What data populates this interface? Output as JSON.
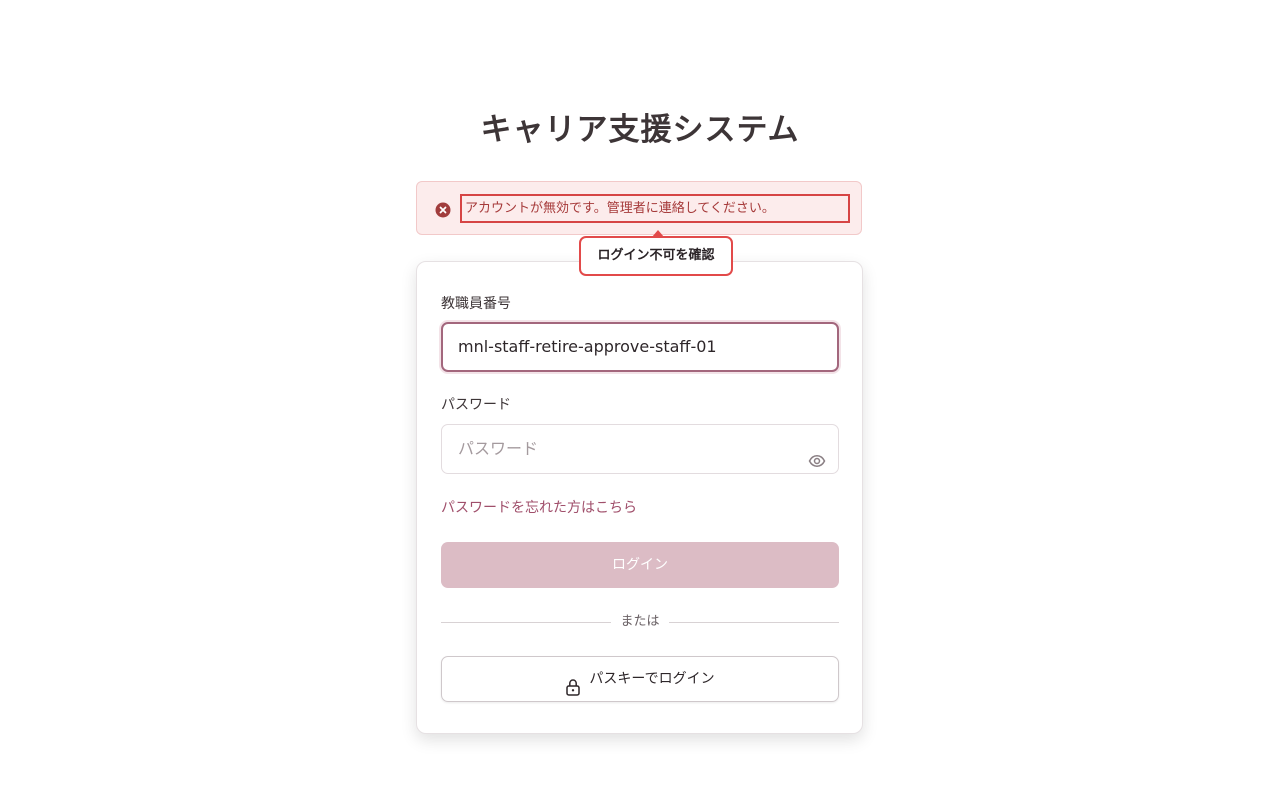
{
  "app": {
    "title": "キャリア支援システム"
  },
  "alert": {
    "icon": "error-circle-icon",
    "message": "アカウントが無効です。管理者に連絡してください。",
    "color": "#a63a3a"
  },
  "callout": {
    "text": "ログイン不可を確認"
  },
  "form": {
    "staff_id": {
      "label": "教職員番号",
      "value": "mnl-staff-retire-approve-staff-01"
    },
    "password": {
      "label": "パスワード",
      "placeholder": "パスワード",
      "value": "",
      "toggle_icon": "eye-icon"
    },
    "forgot_link": "パスワードを忘れた方はこちら",
    "login_button": "ログイン",
    "divider_text": "または",
    "passkey_button": "パスキーでログイン",
    "passkey_icon": "lock-icon"
  },
  "colors": {
    "accent": "#a04f6b",
    "login_button_bg": "#dcbcc5",
    "alert_bg": "#fcecec"
  }
}
